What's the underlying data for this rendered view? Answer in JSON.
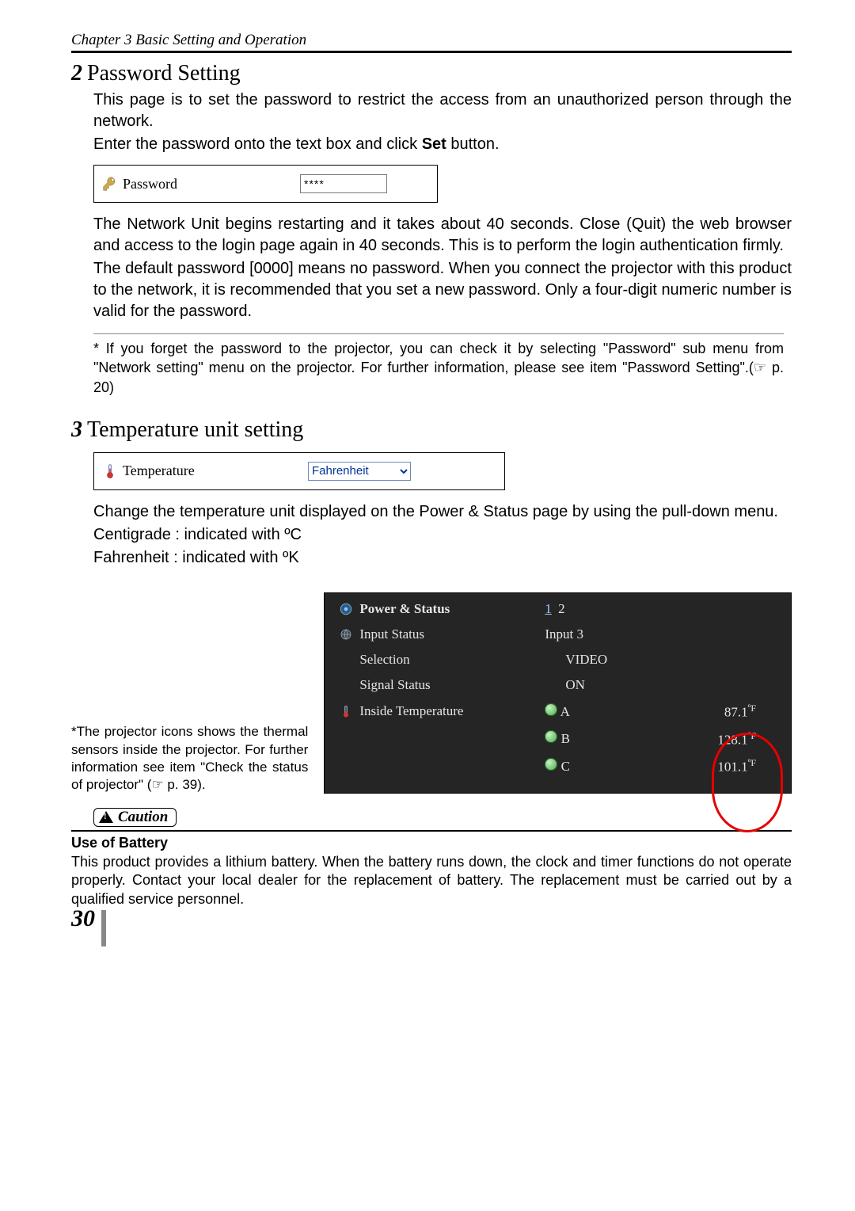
{
  "chapter_header": "Chapter 3 Basic Setting and Operation",
  "section2": {
    "num": "2",
    "title": "Password Setting",
    "para1": "This page is to set the password to restrict the access from an unauthorized person through the network.",
    "para2_pre": "Enter the password onto the text box and click ",
    "para2_bold": "Set",
    "para2_post": " button.",
    "ui_label": "Password",
    "ui_value": "****",
    "para3": "The Network Unit begins restarting and it takes about 40 seconds. Close (Quit) the web browser and access to the login page again in 40 seconds. This is to perform the login authentication firmly.",
    "para4": "The default password [0000] means no password.  When you connect the projector with this product to the network, it is recommended that you set a new password. Only a four-digit numeric number is valid for the password.",
    "footnote": "* If you forget the password to the projector, you can check it by selecting \"Password\" sub menu from \"Network setting\" menu on the projector. For further information, please see item \"Password Setting\".(☞ p. 20)"
  },
  "section3": {
    "num": "3",
    "title": "Temperature unit setting",
    "ui_label": "Temperature",
    "ui_value": "Fahrenheit",
    "para1": "Change the temperature unit displayed on the Power & Status page by using the pull-down  menu.",
    "line_c": "Centigrade : indicated with ºC",
    "line_f": "Fahrenheit : indicated with ºK"
  },
  "side_note": "*The projector icons shows the thermal sensors inside the projector. For further information see item \"Check the status of projector\" (☞ p. 39).",
  "status_panel": {
    "header_label": "Power & Status",
    "header_link1": "1",
    "header_link2": "2",
    "rows": [
      {
        "label": "Input Status",
        "value": "Input 3",
        "indent": false,
        "icon": "globe"
      },
      {
        "label": "Selection",
        "value": "VIDEO",
        "indent": true,
        "icon": ""
      },
      {
        "label": "Signal Status",
        "value": "ON",
        "indent": true,
        "icon": ""
      }
    ],
    "temp_label": "Inside Temperature",
    "temps": [
      {
        "tag": "A",
        "value": "87.1",
        "unit": "ºF"
      },
      {
        "tag": "B",
        "value": "128.1",
        "unit": "ºF"
      },
      {
        "tag": "C",
        "value": "101.1",
        "unit": "ºF"
      }
    ]
  },
  "caution": {
    "badge": "Caution",
    "heading": "Use of Battery",
    "body": "This product provides a lithium battery. When the battery runs down, the clock and timer functions do not operate properly. Contact your local dealer for the replacement of battery. The replacement must be carried out by a qualified service personnel."
  },
  "page_number": "30"
}
